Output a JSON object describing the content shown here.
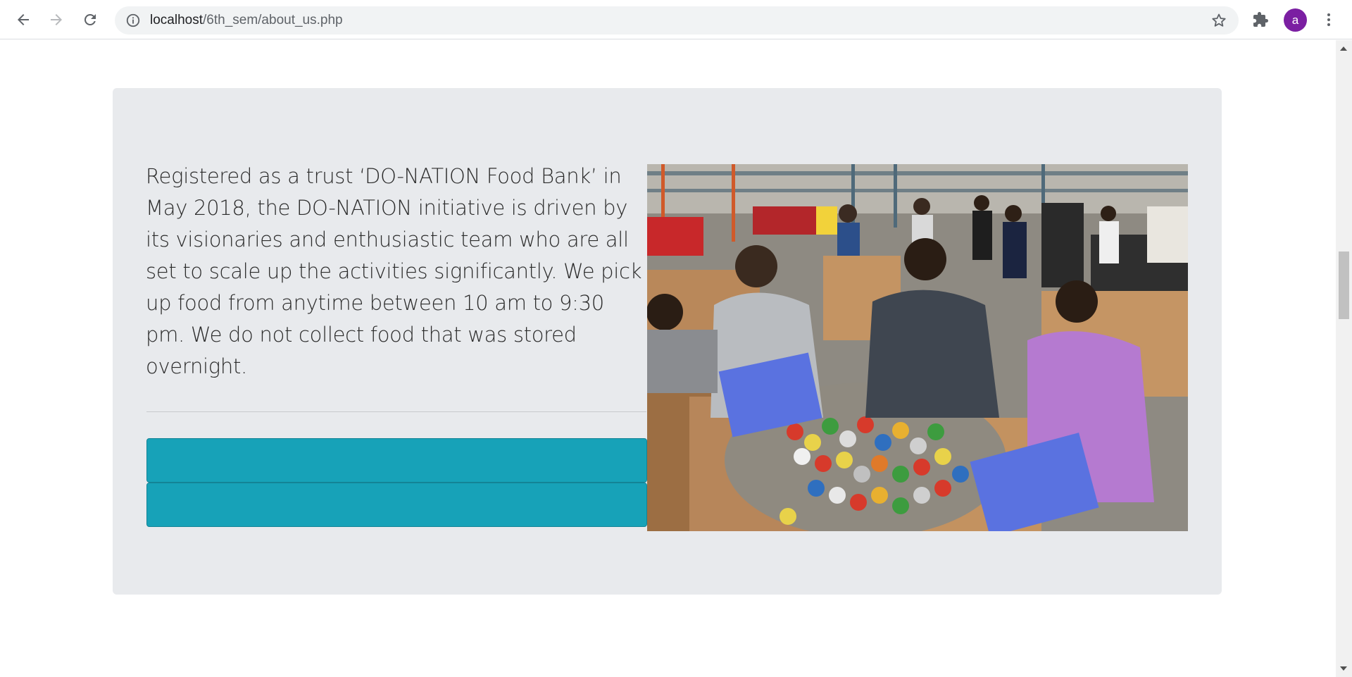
{
  "browser": {
    "url_host": "localhost",
    "url_path": "/6th_sem/about_us.php",
    "profile_initial": "a",
    "icons": {
      "back": "back-arrow-icon",
      "forward": "forward-arrow-icon",
      "reload": "reload-icon",
      "site_info": "info-icon",
      "bookmark": "star-icon",
      "extensions": "puzzle-icon",
      "menu": "kebab-menu-icon"
    }
  },
  "about": {
    "paragraph": "Registered as a trust ‘DO-NATION Food Bank’ in May 2018, the DO-NATION initiative is driven by its visionaries and enthusiastic team who are all set to scale up the activities significantly. We pick up food from anytime between 10 am to 9:30 pm. We do not collect food that was stored overnight.",
    "buttons": [
      {
        "label": ""
      },
      {
        "label": ""
      }
    ]
  },
  "colors": {
    "card_background": "#e8eaed",
    "button": "#17a2b8",
    "avatar": "#7b1fa2"
  }
}
